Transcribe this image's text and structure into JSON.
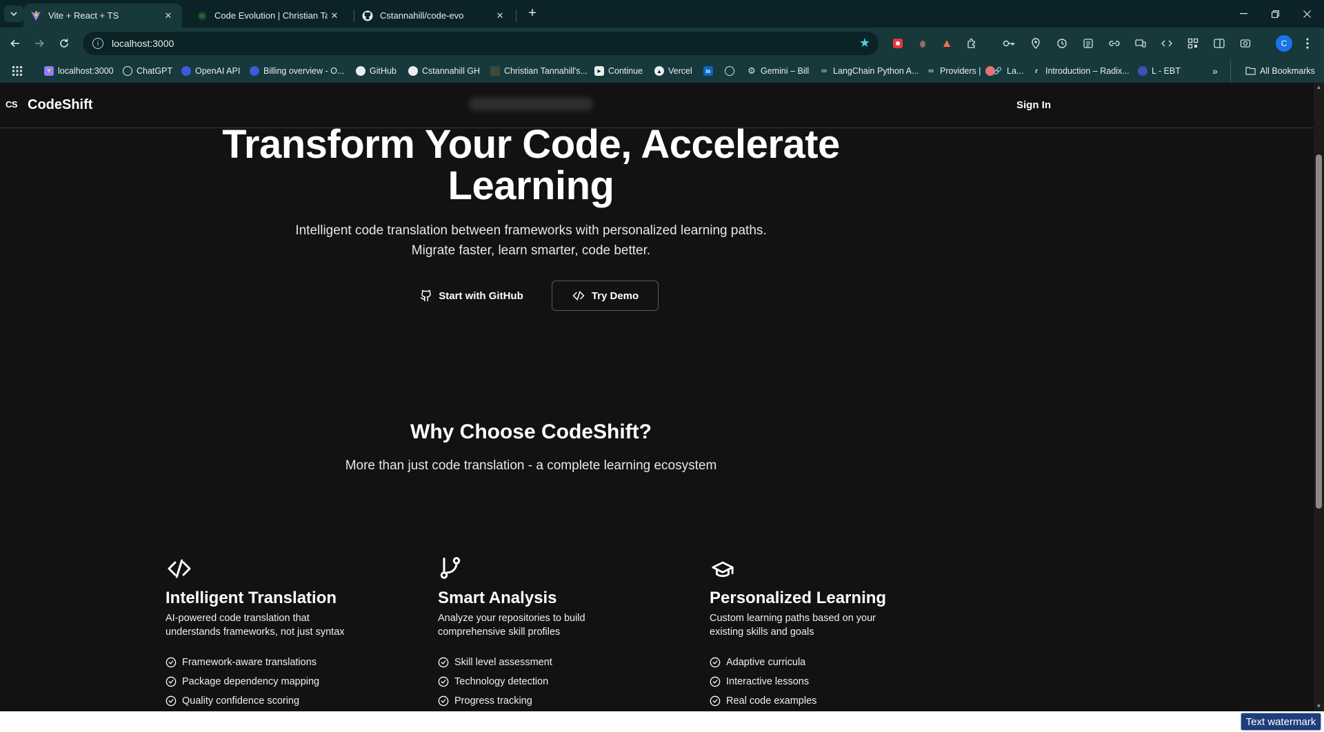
{
  "browser": {
    "tabs": [
      {
        "title": "Vite + React + TS",
        "active": true,
        "favicon": "vite-icon"
      },
      {
        "title": "Code Evolution | Christian Tann",
        "active": false,
        "favicon": "code-evolution-icon"
      },
      {
        "title": "Cstannahill/code-evo",
        "active": false,
        "favicon": "github-icon"
      }
    ],
    "url": "localhost:3000",
    "bookmarks": [
      {
        "label": "localhost:3000",
        "icon": "vite-icon"
      },
      {
        "label": "ChatGPT",
        "icon": "openai-icon"
      },
      {
        "label": "OpenAI API",
        "icon": "openai-icon"
      },
      {
        "label": "Billing overview - O...",
        "icon": "openai-icon"
      },
      {
        "label": "GitHub",
        "icon": "github-icon"
      },
      {
        "label": "Cstannahill GH",
        "icon": "github-icon"
      },
      {
        "label": "Christian Tannahill's...",
        "icon": "site-icon"
      },
      {
        "label": "Continue",
        "icon": "continue-icon"
      },
      {
        "label": "Vercel",
        "icon": "vercel-icon"
      },
      {
        "label": "",
        "icon": "linkedin-icon"
      },
      {
        "label": "",
        "icon": "globe-icon"
      },
      {
        "label": "Gemini – Bill",
        "icon": "gear-icon"
      },
      {
        "label": "LangChain Python A...",
        "icon": "langchain-icon"
      },
      {
        "label": "Providers |",
        "icon": "providers-icon"
      },
      {
        "label": "La...",
        "icon": "link-icon"
      },
      {
        "label": "Introduction – Radix...",
        "icon": "radix-icon"
      },
      {
        "label": "L - EBT",
        "icon": "site-icon"
      }
    ],
    "all_bookmarks": "All Bookmarks",
    "profile_initial": "C",
    "colors": {
      "frame": "#0f2e31",
      "toolbar": "#17393c",
      "accent_star": "#4dd0e1"
    }
  },
  "site": {
    "logo_mark": "CS",
    "logo_text": "CodeShift",
    "signin": "Sign In",
    "hero": {
      "title": "Transform Your Code, Accelerate Learning",
      "subtitle": "Intelligent code translation between frameworks with personalized learning paths. Migrate faster, learn smarter, code better.",
      "cta_github": "Start with GitHub",
      "cta_demo": "Try Demo"
    },
    "why": {
      "title": "Why Choose CodeShift?",
      "subtitle": "More than just code translation - a complete learning ecosystem"
    },
    "features": [
      {
        "icon": "code-icon",
        "title": "Intelligent Translation",
        "description": "AI-powered code translation that understands frameworks, not just syntax",
        "items": [
          "Framework-aware translations",
          "Package dependency mapping",
          "Quality confidence scoring"
        ]
      },
      {
        "icon": "git-branch-icon",
        "title": "Smart Analysis",
        "description": "Analyze your repositories to build comprehensive skill profiles",
        "items": [
          "Skill level assessment",
          "Technology detection",
          "Progress tracking"
        ]
      },
      {
        "icon": "graduation-cap-icon",
        "title": "Personalized Learning",
        "description": "Custom learning paths based on your existing skills and goals",
        "items": [
          "Adaptive curricula",
          "Interactive lessons",
          "Real code examples"
        ]
      }
    ],
    "colors": {
      "background": "#121212",
      "text": "#ffffff"
    }
  },
  "overlay": {
    "watermark": "Text watermark"
  }
}
